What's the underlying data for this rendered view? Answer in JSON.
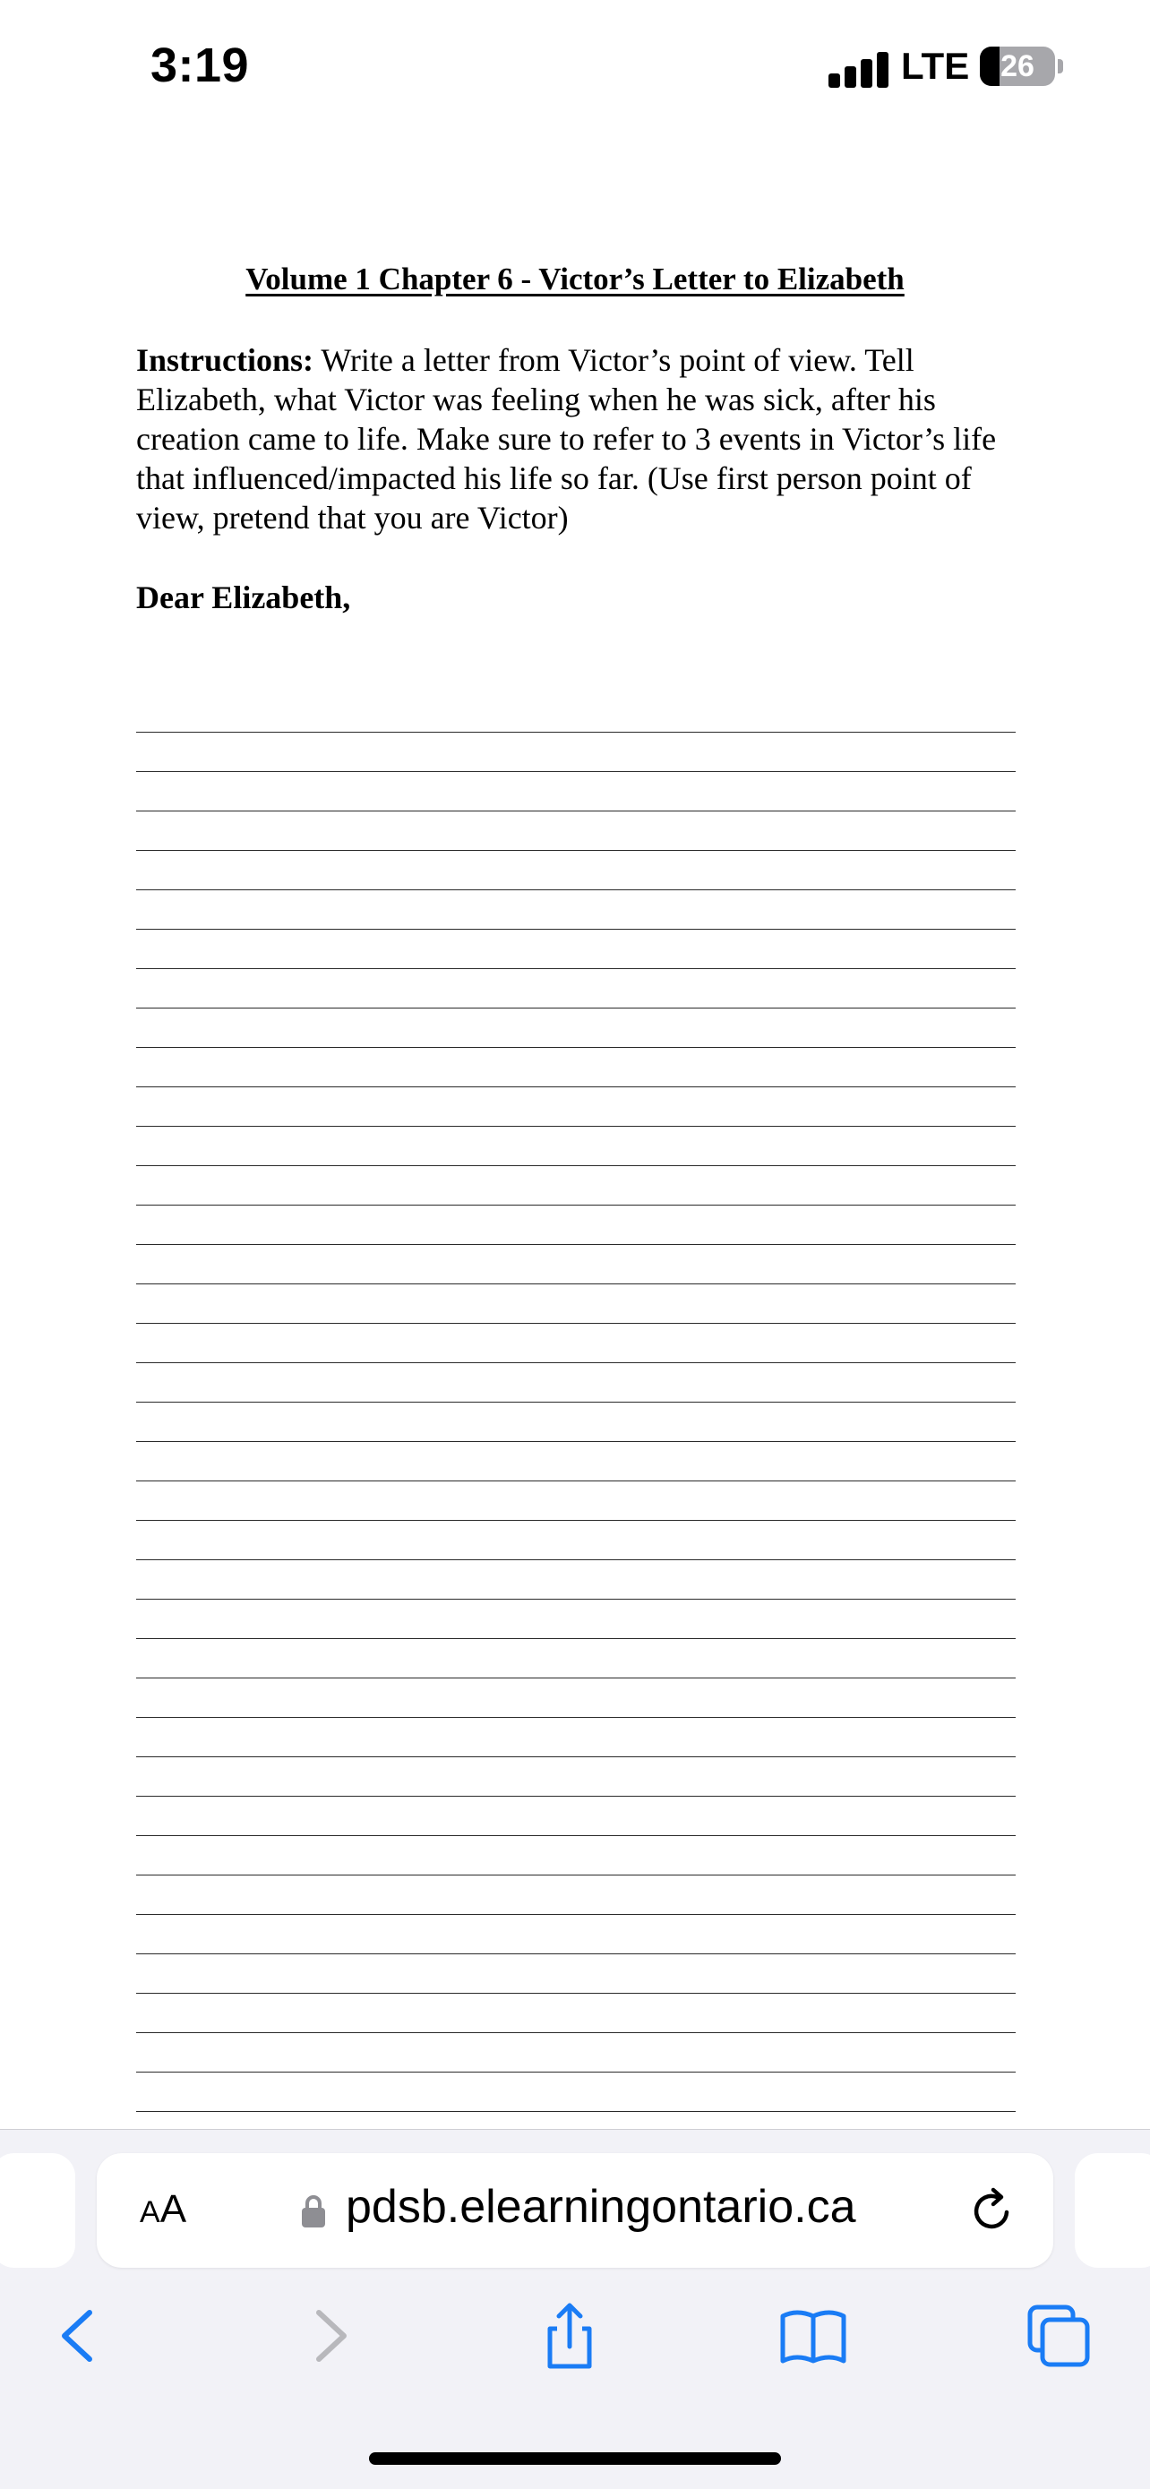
{
  "status": {
    "time": "3:19",
    "network": "LTE",
    "battery": "26"
  },
  "document": {
    "title": "Volume 1 Chapter 6 - Victor’s Letter to Elizabeth",
    "instructions_label": "Instructions:",
    "instructions_text": " Write a letter from Victor’s point of view. Tell Elizabeth, what Victor was feeling when he was sick, after his creation came to life. Make sure to refer to 3 events in Victor’s life that influenced/impacted his life so far. (Use first person point of view, pretend that you are Victor)",
    "salutation": "Dear Elizabeth,"
  },
  "browser": {
    "text_size_label_big": "A",
    "text_size_label_small": "A",
    "url": "pdsb.elearningontario.ca"
  },
  "toolbar": {
    "icons": [
      "back-icon",
      "forward-icon",
      "share-icon",
      "bookmarks-icon",
      "tabs-icon"
    ]
  }
}
